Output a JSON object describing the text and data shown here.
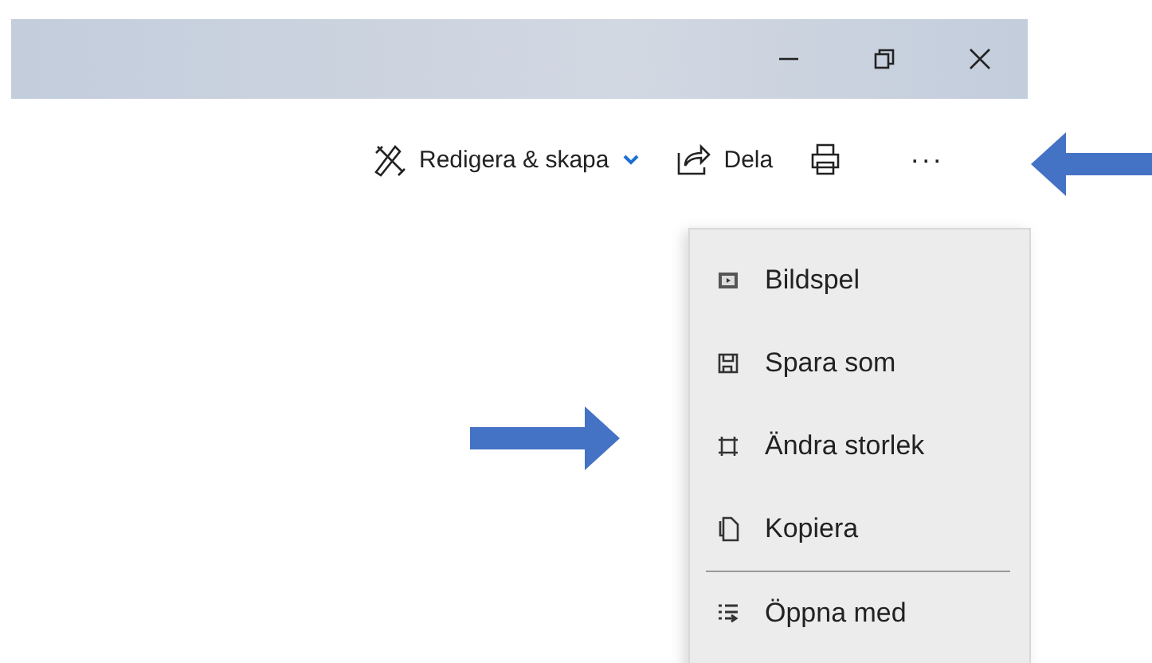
{
  "window": {
    "controls": [
      {
        "kind": "minimize"
      },
      {
        "kind": "restore"
      },
      {
        "kind": "close"
      }
    ]
  },
  "toolbar": [
    {
      "kind": "edit",
      "label": "Redigera & skapa"
    },
    {
      "kind": "share",
      "label": "Dela"
    },
    {
      "kind": "print"
    },
    {
      "kind": "more",
      "label": "···"
    }
  ],
  "menu": {
    "groups": [
      [
        {
          "kind": "slideshow",
          "label": "Bildspel"
        },
        {
          "kind": "save",
          "label": "Spara som"
        },
        {
          "kind": "resize",
          "label": "Ändra storlek"
        },
        {
          "kind": "copy",
          "label": "Kopiera"
        }
      ],
      [
        {
          "kind": "open-with",
          "label": "Öppna med"
        }
      ]
    ]
  },
  "annotations": [
    {
      "kind": "arrow-left"
    },
    {
      "kind": "arrow-right"
    }
  ]
}
